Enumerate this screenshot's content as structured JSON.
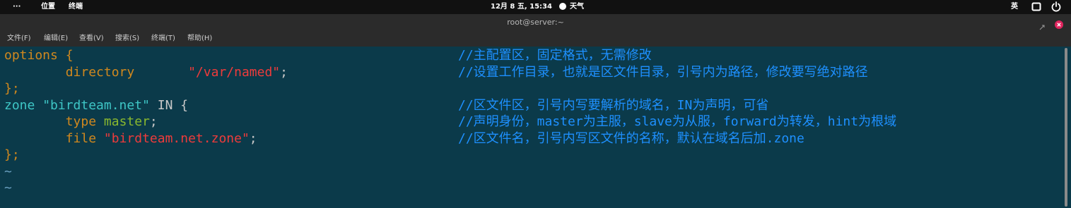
{
  "topbar": {
    "dots": "···",
    "places": "位置",
    "app": "终端",
    "clock": "12月 8 五, 15:34",
    "weather": "天气",
    "input_method": "英"
  },
  "window": {
    "title": "root@server:~"
  },
  "menu": [
    "文件(F)",
    "编辑(E)",
    "查看(V)",
    "搜索(S)",
    "终端(T)",
    "帮助(H)"
  ],
  "editor": {
    "lines": [
      {
        "segments": [
          {
            "t": "options {",
            "c": "y"
          }
        ],
        "comment": "//主配置区，固定格式，无需修改"
      },
      {
        "segments": [
          {
            "t": "        directory       ",
            "c": "y"
          },
          {
            "t": "\"/var/named\"",
            "c": "r"
          },
          {
            "t": ";",
            "c": "w"
          }
        ],
        "comment": "//设置工作目录，也就是区文件目录，引号内为路径，修改要写绝对路径"
      },
      {
        "segments": [
          {
            "t": "};",
            "c": "y"
          }
        ],
        "comment": ""
      },
      {
        "segments": [
          {
            "t": "zone ",
            "c": "c"
          },
          {
            "t": "\"birdteam.net\"",
            "c": "c"
          },
          {
            "t": " IN {",
            "c": "w"
          }
        ],
        "comment": "//区文件区，引号内写要解析的域名，IN为声明，可省"
      },
      {
        "segments": [
          {
            "t": "        type ",
            "c": "y"
          },
          {
            "t": "master",
            "c": "g"
          },
          {
            "t": ";",
            "c": "w"
          }
        ],
        "comment": "//声明身份，master为主服，slave为从服，forward为转发，hint为根域"
      },
      {
        "segments": [
          {
            "t": "        file ",
            "c": "y"
          },
          {
            "t": "\"birdteam.net.zone\"",
            "c": "r"
          },
          {
            "t": ";",
            "c": "w"
          }
        ],
        "comment": "//区文件名，引号内写区文件的名称，默认在域名后加.zone"
      },
      {
        "segments": [
          {
            "t": "};",
            "c": "y"
          }
        ],
        "comment": ""
      },
      {
        "segments": [
          {
            "t": "~",
            "c": "tilde"
          }
        ],
        "comment": ""
      },
      {
        "segments": [
          {
            "t": "~",
            "c": "tilde"
          }
        ],
        "comment": ""
      }
    ]
  },
  "colors": {
    "background": "#0b3a4a",
    "comment": "#1e90ff",
    "keyword": "#d0881e",
    "string": "#ee3b3b",
    "zone": "#3ec6c6",
    "value": "#8ab82e"
  }
}
